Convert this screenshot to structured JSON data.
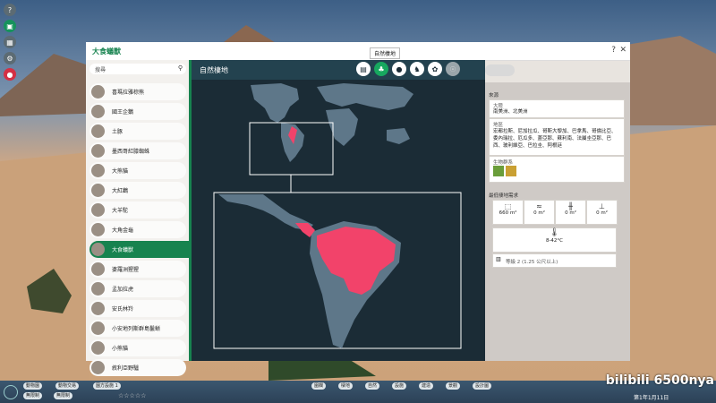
{
  "window": {
    "title": "大食蟻獸",
    "tooltip": "自然棲地",
    "help": "?",
    "close": "✕"
  },
  "hud": {
    "help": "?"
  },
  "sidebar": {
    "search_placeholder": "搜尋",
    "animals": [
      "喜瑪拉雅棕熊",
      "國王企鵝",
      "土豚",
      "墨西哥紅膝蜘蛛",
      "大熊貓",
      "大紅鸛",
      "大羊駝",
      "大角金龜",
      "大食蟻獸",
      "婆羅洲猩猩",
      "孟加拉虎",
      "安氏林羚",
      "小安地列斯群島鬣蜥",
      "小熊貓",
      "敘利亞野驢"
    ],
    "selected_index": 8
  },
  "main": {
    "section_title": "自然棲地",
    "tabs": [
      "info-tab-icon",
      "habitat-tab-icon",
      "diet-tab-icon",
      "enrichment-tab-icon",
      "social-tab-icon",
      "breeding-tab-icon"
    ],
    "active_tab": 1
  },
  "details": {
    "origin_label": "來源",
    "continent_label": "大陸",
    "continent_value": "南美洲、北美洲",
    "region_label": "地區",
    "region_value": "宏都拉斯、尼加拉瓜、哥斯大黎加、巴拿馬、哥倫比亞、委內瑞拉、厄瓜多、蓋亞那、蘇利南、法屬圭亞那、巴西、玻利維亞、巴拉圭、阿根廷",
    "biome_label": "生物群系",
    "habitat_label": "最低棲地需求",
    "stats": [
      "660 m²",
      "0 m²",
      "0 m²",
      "0 m²"
    ],
    "temperature": "8-42°C",
    "fence": "等級 2 (1.25 公尺以上)"
  },
  "bottom": {
    "left_buttons": [
      "動物園",
      "動物交易",
      "園方設施 1",
      "無限制",
      "無限制"
    ],
    "center_buttons": [
      "圍欄",
      "棲地",
      "自然",
      "設施",
      "建造",
      "景觀",
      "設計圖"
    ],
    "date": "第1年1月11日"
  },
  "watermark": "bilibili 6500nya",
  "colors": {
    "accent": "#17834f",
    "range": "#f2436a",
    "land": "#5e7789",
    "ocean": "#1b2c36"
  }
}
